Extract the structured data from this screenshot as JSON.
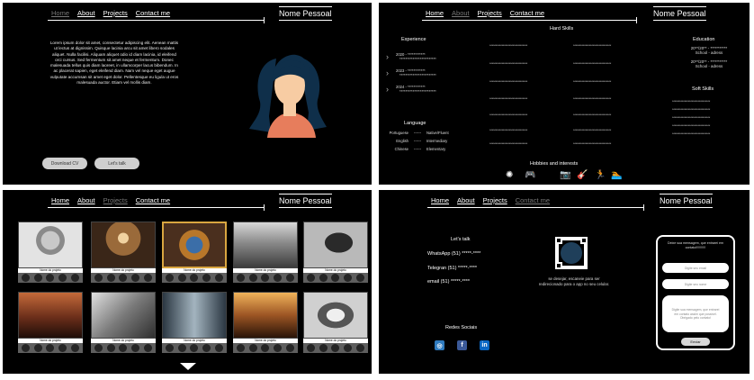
{
  "brand": "Nome Pessoal",
  "nav": [
    "Home",
    "About",
    "Projects",
    "Contact me"
  ],
  "about": {
    "text": "Lorem ipsum dolor sit amet, consectetur adipiscing elit. Aenean mattis ut lectus at dignissim. Quisque lacinia arcu sit amet libero sodales aliquet. Nulla facilisi. Aliquam aliquet odio id diam lacinia, id eleifend orci cursus. Sed fermentum sit amet neque et fermentum. Donec malesuada tellus quis diam laoreet, in ullamcorper lacus bibendum. In ac placerat sapien, eget eleifend diam. Nam vel neque eget augue vulputate accumsan sit amet eget dolor. Pellentesque eu ligula ut eros malesuada auctor. Etiam vel mollis diam.",
    "download_label": "Download CV",
    "talk_label": "Let's talk"
  },
  "resume": {
    "experience_title": "Experience",
    "experience": [
      {
        "year": "2020 - ************",
        "desc": "*************************"
      },
      {
        "year": "2023 - ************",
        "desc": "*************************"
      },
      {
        "year": "2024 - ************",
        "desc": "*************************"
      }
    ],
    "language_title": "Language",
    "languages": [
      {
        "name": "Portuguese",
        "level": "Native/Fluent"
      },
      {
        "name": "English",
        "level": "Intermediary"
      },
      {
        "name": "Chinese",
        "level": "Elementary"
      }
    ],
    "lang_dash": "------",
    "hard_skills_title": "Hard Skills",
    "stars": "*******************************",
    "education_title": "Education",
    "education": [
      {
        "line1": "20**/20** - ***********",
        "line2": "School - adress"
      },
      {
        "line1": "20**/20** - ***********",
        "line2": "School - adress"
      }
    ],
    "soft_skills_title": "Soft Skills",
    "hobbies_title": "Hobbies and interests",
    "hobby_icons": [
      "brain-icon",
      "gamepad-icon",
      "camera-icon",
      "guitar-icon",
      "running-icon",
      "swimming-icon"
    ]
  },
  "projects": {
    "caption": "Nome do projeto"
  },
  "contact": {
    "title": "Let's talk",
    "whatsapp": "WhatsApp (51) *****-****",
    "telegram": "Telegran (51) *****-****",
    "email": "email (51) *****-****",
    "qr_text": "se desejar, escaneie para ser redirecionado para o app no seu celular.",
    "social_title": "Redes Sociais",
    "form_intro": "Deixe sua mensagem, que entrarei em contato!!!!!!!!!!!",
    "email_placeholder": "Digite seu email",
    "name_placeholder": "Digite seu nome",
    "message_placeholder": "Digite sua mensagem, que entrarei em contato assim que possivel. Obrigado pelo contato!",
    "send_label": "Enviar"
  }
}
